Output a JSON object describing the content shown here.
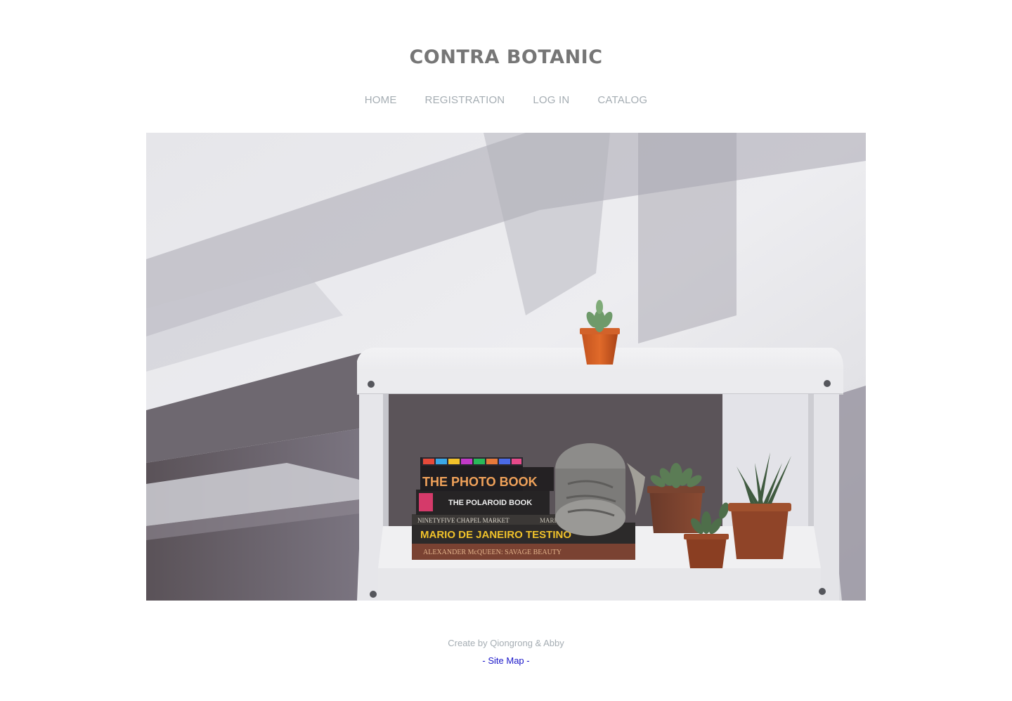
{
  "site": {
    "title": "CONTRA BOTANIC"
  },
  "nav": {
    "items": [
      {
        "label": "HOME"
      },
      {
        "label": "REGISTRATION"
      },
      {
        "label": "LOG IN"
      },
      {
        "label": "CATALOG"
      }
    ]
  },
  "hero": {
    "books": {
      "book1": "THE PHOTO BOOK",
      "book2": "THE POLAROID BOOK",
      "book3": "NINETYFIVE CHAPEL MARKET",
      "book3_right": "MARIANO",
      "book4": "MARIO DE JANEIRO TESTINO",
      "book5": "ALEXANDER McQUEEN: SAVAGE BEAUTY"
    }
  },
  "footer": {
    "credit": "Create by Qiongrong & Abby",
    "sitemap_label": "- Site Map -"
  },
  "colors": {
    "title": "#767676",
    "nav": "#a5adb3",
    "link": "#1a16c9"
  }
}
